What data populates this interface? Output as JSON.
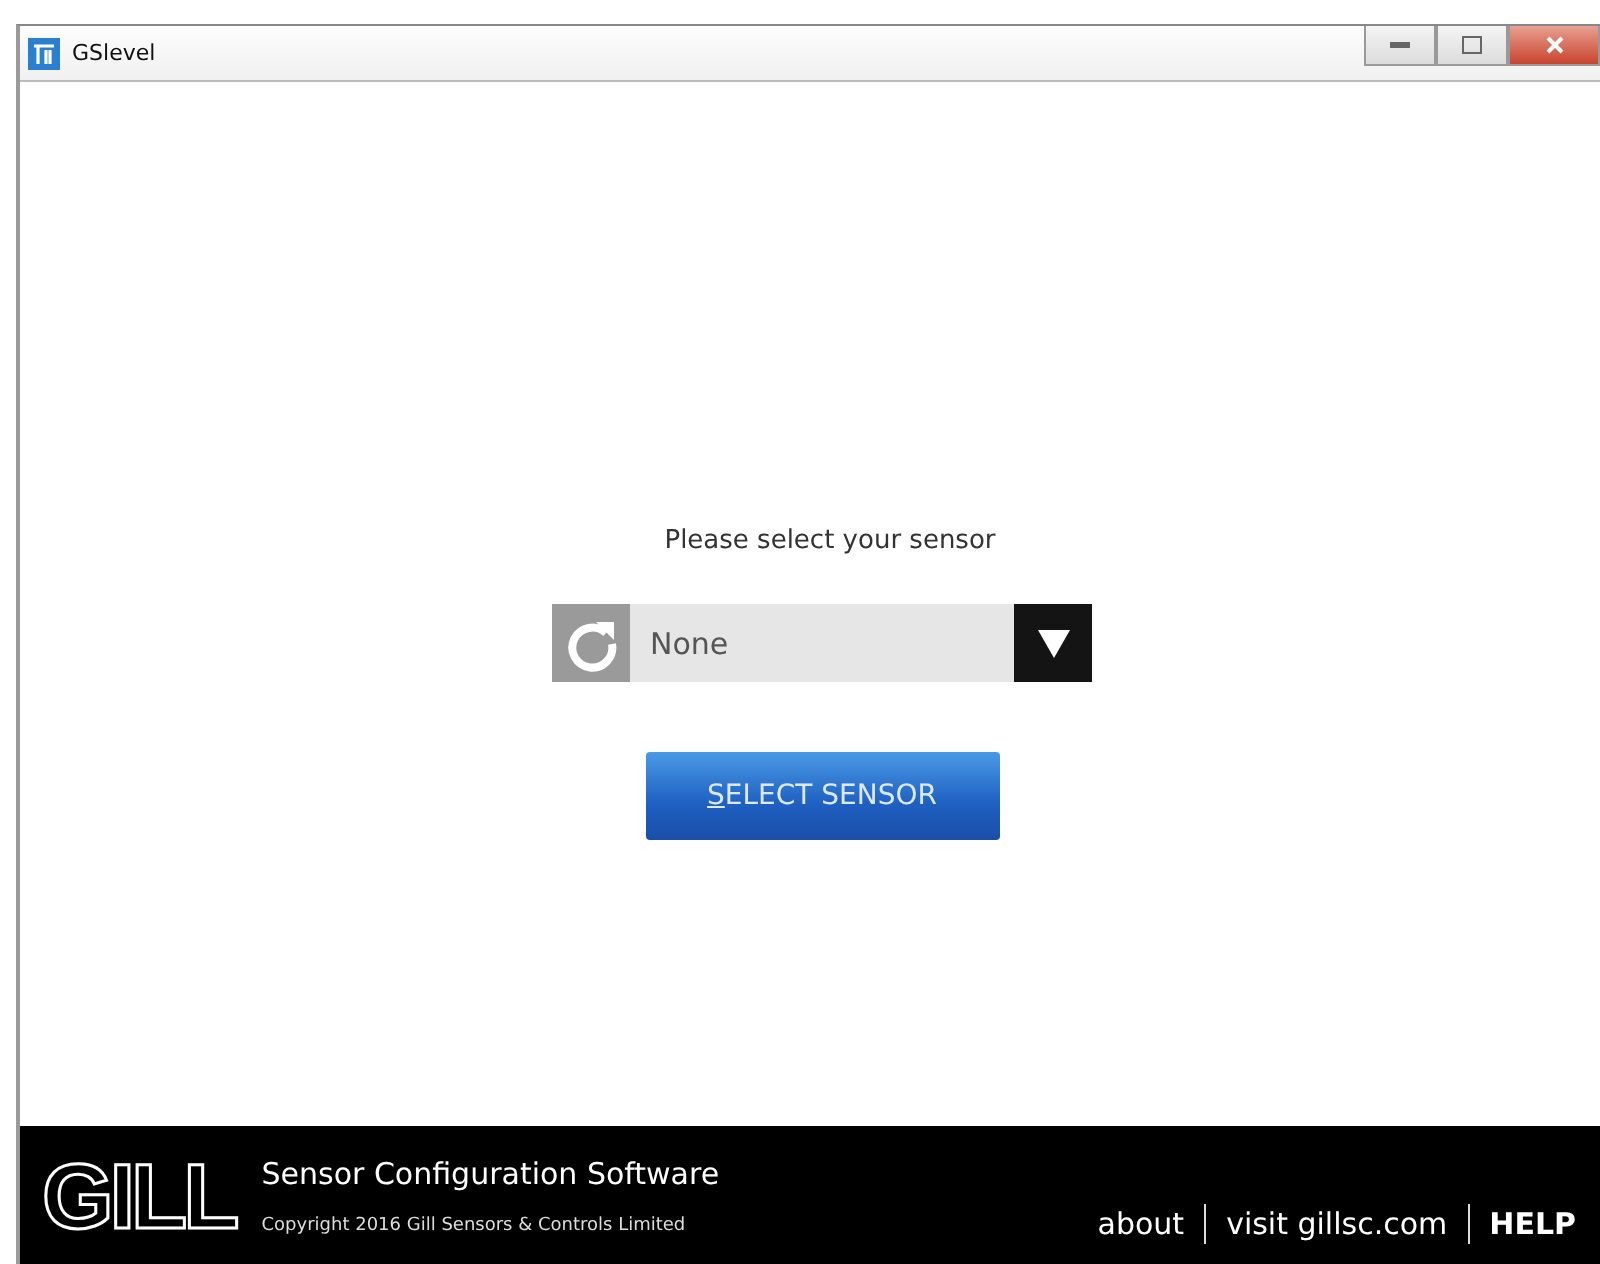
{
  "window": {
    "title": "GSlevel"
  },
  "prompt": "Please select your sensor",
  "sensor_select": {
    "value": "None"
  },
  "select_button": {
    "label": "SELECT SENSOR"
  },
  "footer": {
    "logo": "GILL",
    "product": "Sensor Configuration Software",
    "copyright": "Copyright 2016 Gill Sensors & Controls Limited",
    "links": [
      {
        "label": "about",
        "bold": false
      },
      {
        "label": "visit gillsc.com",
        "bold": false
      },
      {
        "label": "HELP",
        "bold": true
      }
    ]
  }
}
